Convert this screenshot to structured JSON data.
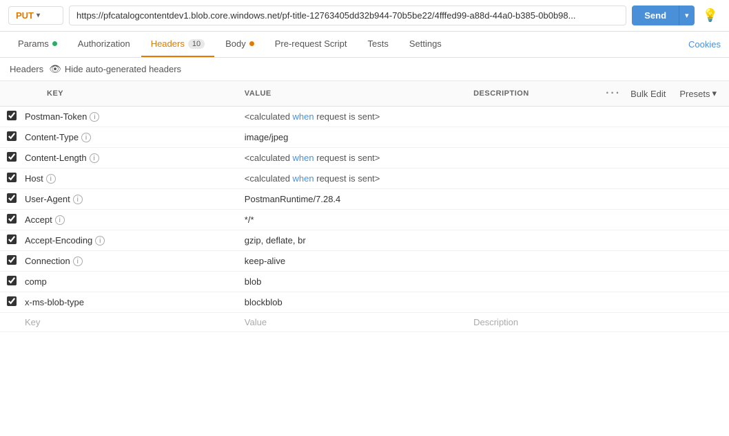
{
  "topbar": {
    "method": "PUT",
    "url": "https://pfcatalogcontentdev1.blob.core.windows.net/pf-title-12763405dd32b944-70b5be22/4fffed99-a88d-44a0-b385-0b0b98...",
    "send_label": "Send",
    "send_dropdown_icon": "▾",
    "settings_icon": "💡"
  },
  "tabs": [
    {
      "id": "params",
      "label": "Params",
      "dot": "green",
      "active": false
    },
    {
      "id": "authorization",
      "label": "Authorization",
      "dot": null,
      "active": false
    },
    {
      "id": "headers",
      "label": "Headers",
      "badge": "10",
      "dot": null,
      "active": true
    },
    {
      "id": "body",
      "label": "Body",
      "dot": "orange",
      "active": false
    },
    {
      "id": "prerequest",
      "label": "Pre-request Script",
      "dot": null,
      "active": false
    },
    {
      "id": "tests",
      "label": "Tests",
      "dot": null,
      "active": false
    },
    {
      "id": "settings",
      "label": "Settings",
      "dot": null,
      "active": false
    }
  ],
  "cookies_label": "Cookies",
  "subheader": {
    "title": "Headers",
    "hide_auto_label": "Hide auto-generated headers"
  },
  "table": {
    "columns": {
      "key": "KEY",
      "value": "VALUE",
      "description": "DESCRIPTION",
      "bulk_edit": "Bulk Edit",
      "presets": "Presets"
    },
    "rows": [
      {
        "checked": true,
        "key": "Postman-Token",
        "has_info": true,
        "value_type": "calculated",
        "value": "<calculated when request is sent>",
        "value_when": "when",
        "description": ""
      },
      {
        "checked": true,
        "key": "Content-Type",
        "has_info": true,
        "value_type": "plain",
        "value": "image/jpeg",
        "description": ""
      },
      {
        "checked": true,
        "key": "Content-Length",
        "has_info": true,
        "value_type": "calculated",
        "value": "<calculated when request is sent>",
        "description": ""
      },
      {
        "checked": true,
        "key": "Host",
        "has_info": true,
        "value_type": "calculated",
        "value": "<calculated when request is sent>",
        "description": ""
      },
      {
        "checked": true,
        "key": "User-Agent",
        "has_info": true,
        "value_type": "plain",
        "value": "PostmanRuntime/7.28.4",
        "description": ""
      },
      {
        "checked": true,
        "key": "Accept",
        "has_info": true,
        "value_type": "plain",
        "value": "*/*",
        "description": ""
      },
      {
        "checked": true,
        "key": "Accept-Encoding",
        "has_info": true,
        "value_type": "plain",
        "value": "gzip, deflate, br",
        "description": ""
      },
      {
        "checked": true,
        "key": "Connection",
        "has_info": true,
        "value_type": "plain",
        "value": "keep-alive",
        "description": ""
      },
      {
        "checked": true,
        "key": "comp",
        "has_info": false,
        "value_type": "plain",
        "value": "blob",
        "description": ""
      },
      {
        "checked": true,
        "key": "x-ms-blob-type",
        "has_info": false,
        "value_type": "plain",
        "value": "blockblob",
        "description": ""
      }
    ],
    "placeholder": {
      "key": "Key",
      "value": "Value",
      "description": "Description"
    }
  }
}
